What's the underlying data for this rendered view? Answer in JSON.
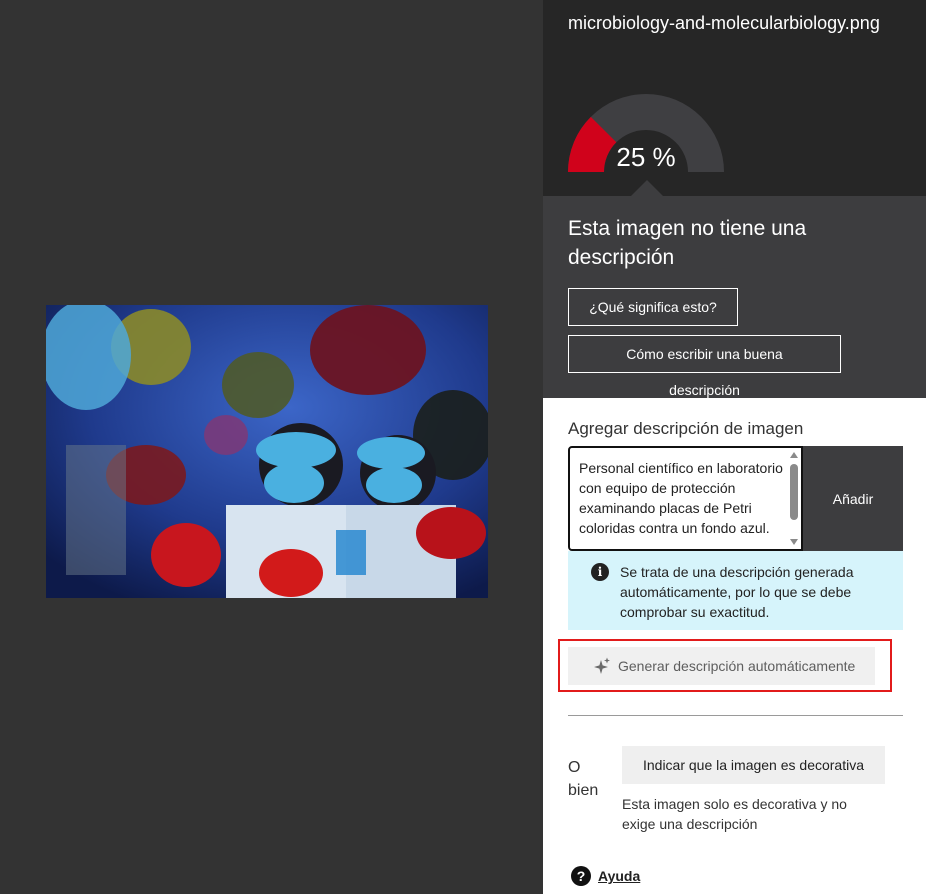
{
  "file": {
    "name": "microbiology-and-molecularbiology.png"
  },
  "score": {
    "percent": 25,
    "label": "25 %"
  },
  "status": {
    "title": "Esta imagen no tiene una descripción",
    "what_means_button": "¿Qué significa esto?",
    "how_to_write_button": "Cómo escribir una buena descripción"
  },
  "editor": {
    "label": "Agregar descripción de imagen",
    "value": "Personal científico en laboratorio con equipo de protección examinando placas de Petri coloridas contra un fondo azul.",
    "add_button": "Añadir",
    "auto_note": "Se trata de una descripción generada automáticamente, por lo que se debe comprobar su exactitud.",
    "generate_button": "Generar descripción automáticamente"
  },
  "decorative": {
    "or_label": "O bien",
    "button": "Indicar que la imagen es decorativa",
    "note": "Esta imagen solo es decorativa y no exige una descripción"
  },
  "help": {
    "label": "Ayuda"
  },
  "colors": {
    "gauge_fill": "#d0021b",
    "gauge_track": "#3f3f42",
    "highlight": "#e21b1b",
    "note_bg": "#d6f4fb"
  },
  "icons": [
    "info-icon",
    "sparkle-icon",
    "help-icon"
  ]
}
